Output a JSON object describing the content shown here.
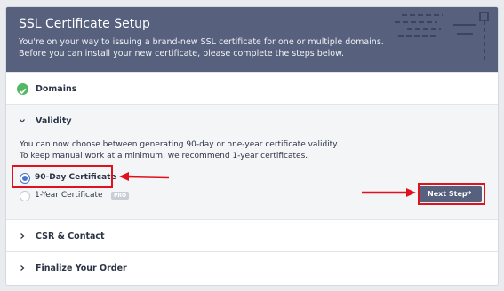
{
  "header": {
    "title": "SSL Certificate Setup",
    "line1": "You're on your way to issuing a brand-new SSL certificate for one or multiple domains.",
    "line2": "Before you can install your new certificate, please complete the steps below."
  },
  "steps": {
    "domains": "Domains",
    "validity": "Validity",
    "csr": "CSR & Contact",
    "finalize": "Finalize Your Order"
  },
  "validity": {
    "desc1": "You can now choose between generating 90-day or one-year certificate validity.",
    "desc2": "To keep manual work at a minimum, we recommend 1-year certificates.",
    "options": [
      {
        "label": "90-Day Certificate",
        "selected": true
      },
      {
        "label": "1-Year Certificate",
        "selected": false,
        "badge": "PRO"
      }
    ],
    "next_label": "Next Step"
  },
  "colors": {
    "header_bg": "#57607d",
    "success": "#53b763",
    "accent": "#4b73c9",
    "annotation": "#e0121d"
  }
}
